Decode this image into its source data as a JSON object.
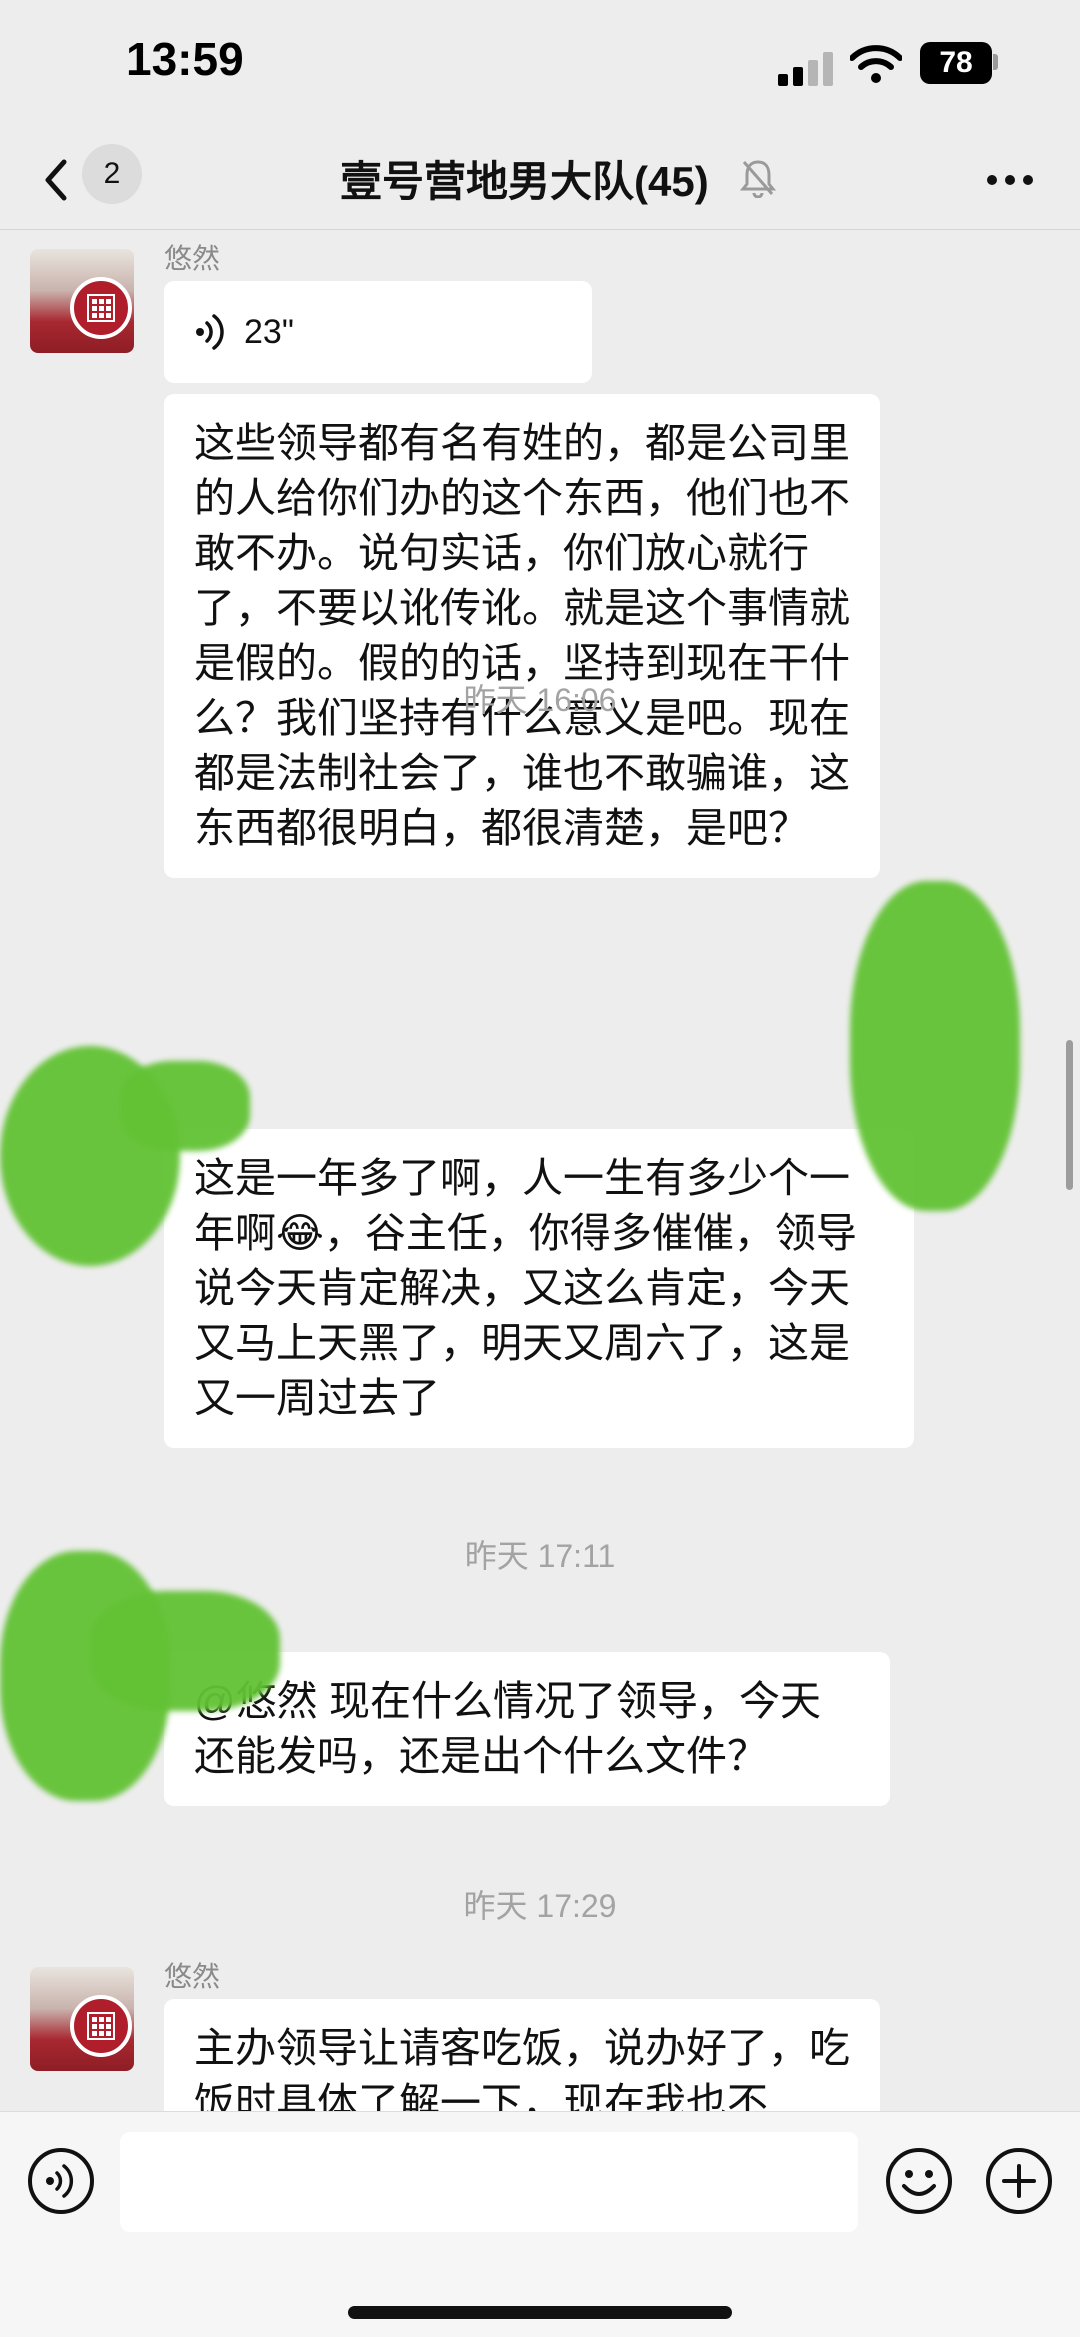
{
  "status": {
    "time": "13:59",
    "battery": "78"
  },
  "nav": {
    "unread": "2",
    "title": "壹号营地男大队(45)"
  },
  "messages": [
    {
      "sender": "悠然",
      "voice_duration": "23\""
    },
    {
      "text": "这些领导都有名有姓的，都是公司里的人给你们办的这个东西，他们也不敢不办。说句实话，你们放心就行了，不要以讹传讹。就是这个事情就是假的。假的的话，坚持到现在干什么？我们坚持有什么意义是吧。现在都是法制社会了，谁也不敢骗谁，这东西都很明白，都很清楚，是吧？"
    },
    {
      "timestamp": "昨天 16:06"
    },
    {
      "text": "这是一年多了啊，人一生有多少个一年啊😂，谷主任，你得多催催，领导说今天肯定解决，又这么肯定，今天又马上天黑了，明天又周六了，这是又一周过去了"
    },
    {
      "timestamp": "昨天 17:11"
    },
    {
      "text": "@悠然 现在什么情况了领导，今天还能发吗，还是出个什么文件？"
    },
    {
      "timestamp": "昨天 17:29"
    },
    {
      "sender": "悠然",
      "text": "主办领导让请客吃饭，说办好了，吃饭时具体了解一下，现在我也不"
    }
  ],
  "icons": {
    "back": "chevron-left-icon",
    "mute": "bell-off-icon",
    "more": "more-dots-icon",
    "voice": "voice-icon",
    "emoji": "emoji-icon",
    "add": "plus-circle-icon"
  },
  "colors": {
    "background": "#ededed",
    "bubble": "#ffffff",
    "timestamp": "#a3a3a3",
    "redaction": "#62c234"
  }
}
